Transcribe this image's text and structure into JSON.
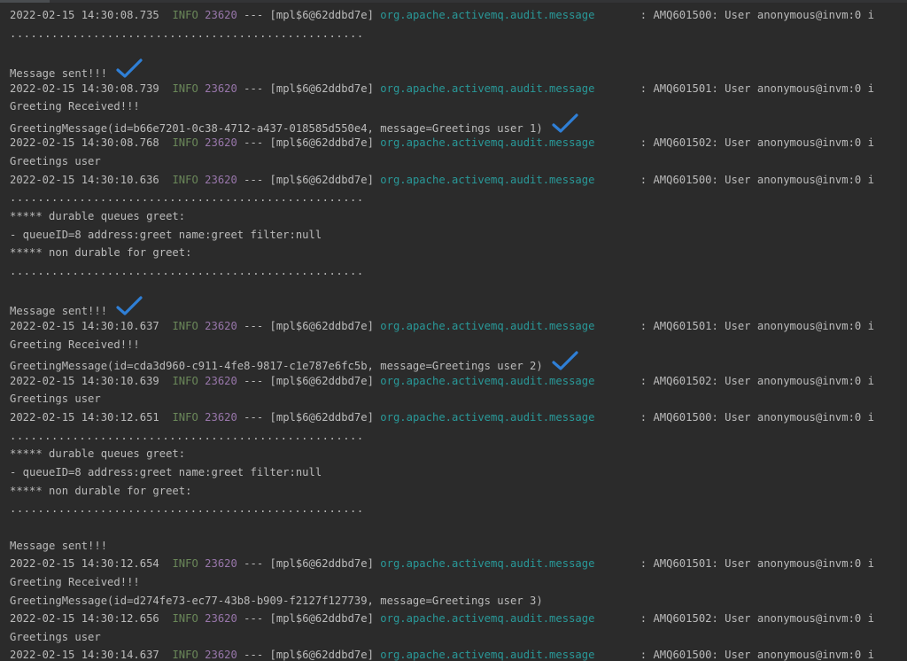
{
  "console": {
    "lines": [
      {
        "kind": "log",
        "timestamp": "2022-02-15 14:30:08.735",
        "level": "INFO",
        "pid": "23620",
        "thread": " --- [mpl$6@62ddbd7e]",
        "logger": "org.apache.activemq.audit.message",
        "message": "       : AMQ601500: User anonymous@invm:0 i"
      },
      {
        "kind": "text",
        "text": "...................................................",
        "check": false
      },
      {
        "kind": "text",
        "text": "",
        "check": false
      },
      {
        "kind": "text",
        "text": "Message sent!!!",
        "check": true
      },
      {
        "kind": "log",
        "timestamp": "2022-02-15 14:30:08.739",
        "level": "INFO",
        "pid": "23620",
        "thread": " --- [mpl$6@62ddbd7e]",
        "logger": "org.apache.activemq.audit.message",
        "message": "       : AMQ601501: User anonymous@invm:0 i"
      },
      {
        "kind": "text",
        "text": "Greeting Received!!!",
        "check": false
      },
      {
        "kind": "text",
        "text": "GreetingMessage(id=b66e7201-0c38-4712-a437-018585d550e4, message=Greetings user 1)",
        "check": true
      },
      {
        "kind": "log",
        "timestamp": "2022-02-15 14:30:08.768",
        "level": "INFO",
        "pid": "23620",
        "thread": " --- [mpl$6@62ddbd7e]",
        "logger": "org.apache.activemq.audit.message",
        "message": "       : AMQ601502: User anonymous@invm:0 i"
      },
      {
        "kind": "text",
        "text": "Greetings user",
        "check": false
      },
      {
        "kind": "log",
        "timestamp": "2022-02-15 14:30:10.636",
        "level": "INFO",
        "pid": "23620",
        "thread": " --- [mpl$6@62ddbd7e]",
        "logger": "org.apache.activemq.audit.message",
        "message": "       : AMQ601500: User anonymous@invm:0 i"
      },
      {
        "kind": "text",
        "text": "...................................................",
        "check": false
      },
      {
        "kind": "text",
        "text": "***** durable queues greet:",
        "check": false
      },
      {
        "kind": "text",
        "text": "- queueID=8 address:greet name:greet filter:null",
        "check": false
      },
      {
        "kind": "text",
        "text": "***** non durable for greet:",
        "check": false
      },
      {
        "kind": "text",
        "text": "...................................................",
        "check": false
      },
      {
        "kind": "text",
        "text": "",
        "check": false
      },
      {
        "kind": "text",
        "text": "Message sent!!!",
        "check": true
      },
      {
        "kind": "log",
        "timestamp": "2022-02-15 14:30:10.637",
        "level": "INFO",
        "pid": "23620",
        "thread": " --- [mpl$6@62ddbd7e]",
        "logger": "org.apache.activemq.audit.message",
        "message": "       : AMQ601501: User anonymous@invm:0 i"
      },
      {
        "kind": "text",
        "text": "Greeting Received!!!",
        "check": false
      },
      {
        "kind": "text",
        "text": "GreetingMessage(id=cda3d960-c911-4fe8-9817-c1e787e6fc5b, message=Greetings user 2)",
        "check": true
      },
      {
        "kind": "log",
        "timestamp": "2022-02-15 14:30:10.639",
        "level": "INFO",
        "pid": "23620",
        "thread": " --- [mpl$6@62ddbd7e]",
        "logger": "org.apache.activemq.audit.message",
        "message": "       : AMQ601502: User anonymous@invm:0 i"
      },
      {
        "kind": "text",
        "text": "Greetings user",
        "check": false
      },
      {
        "kind": "log",
        "timestamp": "2022-02-15 14:30:12.651",
        "level": "INFO",
        "pid": "23620",
        "thread": " --- [mpl$6@62ddbd7e]",
        "logger": "org.apache.activemq.audit.message",
        "message": "       : AMQ601500: User anonymous@invm:0 i"
      },
      {
        "kind": "text",
        "text": "...................................................",
        "check": false
      },
      {
        "kind": "text",
        "text": "***** durable queues greet:",
        "check": false
      },
      {
        "kind": "text",
        "text": "- queueID=8 address:greet name:greet filter:null",
        "check": false
      },
      {
        "kind": "text",
        "text": "***** non durable for greet:",
        "check": false
      },
      {
        "kind": "text",
        "text": "...................................................",
        "check": false
      },
      {
        "kind": "text",
        "text": "",
        "check": false
      },
      {
        "kind": "text",
        "text": "Message sent!!!",
        "check": false
      },
      {
        "kind": "log",
        "timestamp": "2022-02-15 14:30:12.654",
        "level": "INFO",
        "pid": "23620",
        "thread": " --- [mpl$6@62ddbd7e]",
        "logger": "org.apache.activemq.audit.message",
        "message": "       : AMQ601501: User anonymous@invm:0 i"
      },
      {
        "kind": "text",
        "text": "Greeting Received!!!",
        "check": false
      },
      {
        "kind": "text",
        "text": "GreetingMessage(id=d274fe73-ec77-43b8-b909-f2127f127739, message=Greetings user 3)",
        "check": false
      },
      {
        "kind": "log",
        "timestamp": "2022-02-15 14:30:12.656",
        "level": "INFO",
        "pid": "23620",
        "thread": " --- [mpl$6@62ddbd7e]",
        "logger": "org.apache.activemq.audit.message",
        "message": "       : AMQ601502: User anonymous@invm:0 i"
      },
      {
        "kind": "text",
        "text": "Greetings user",
        "check": false
      },
      {
        "kind": "log",
        "timestamp": "2022-02-15 14:30:14.637",
        "level": "INFO",
        "pid": "23620",
        "thread": " --- [mpl$6@62ddbd7e]",
        "logger": "org.apache.activemq.audit.message",
        "message": "       : AMQ601500: User anonymous@invm:0 i"
      }
    ]
  },
  "icons": {
    "check": "checkmark-icon"
  },
  "colors": {
    "background": "#2b2b2b",
    "text": "#bbbbbb",
    "level": "#6a8759",
    "pid": "#9876aa",
    "logger": "#299999",
    "check": "#2f7fd6"
  }
}
